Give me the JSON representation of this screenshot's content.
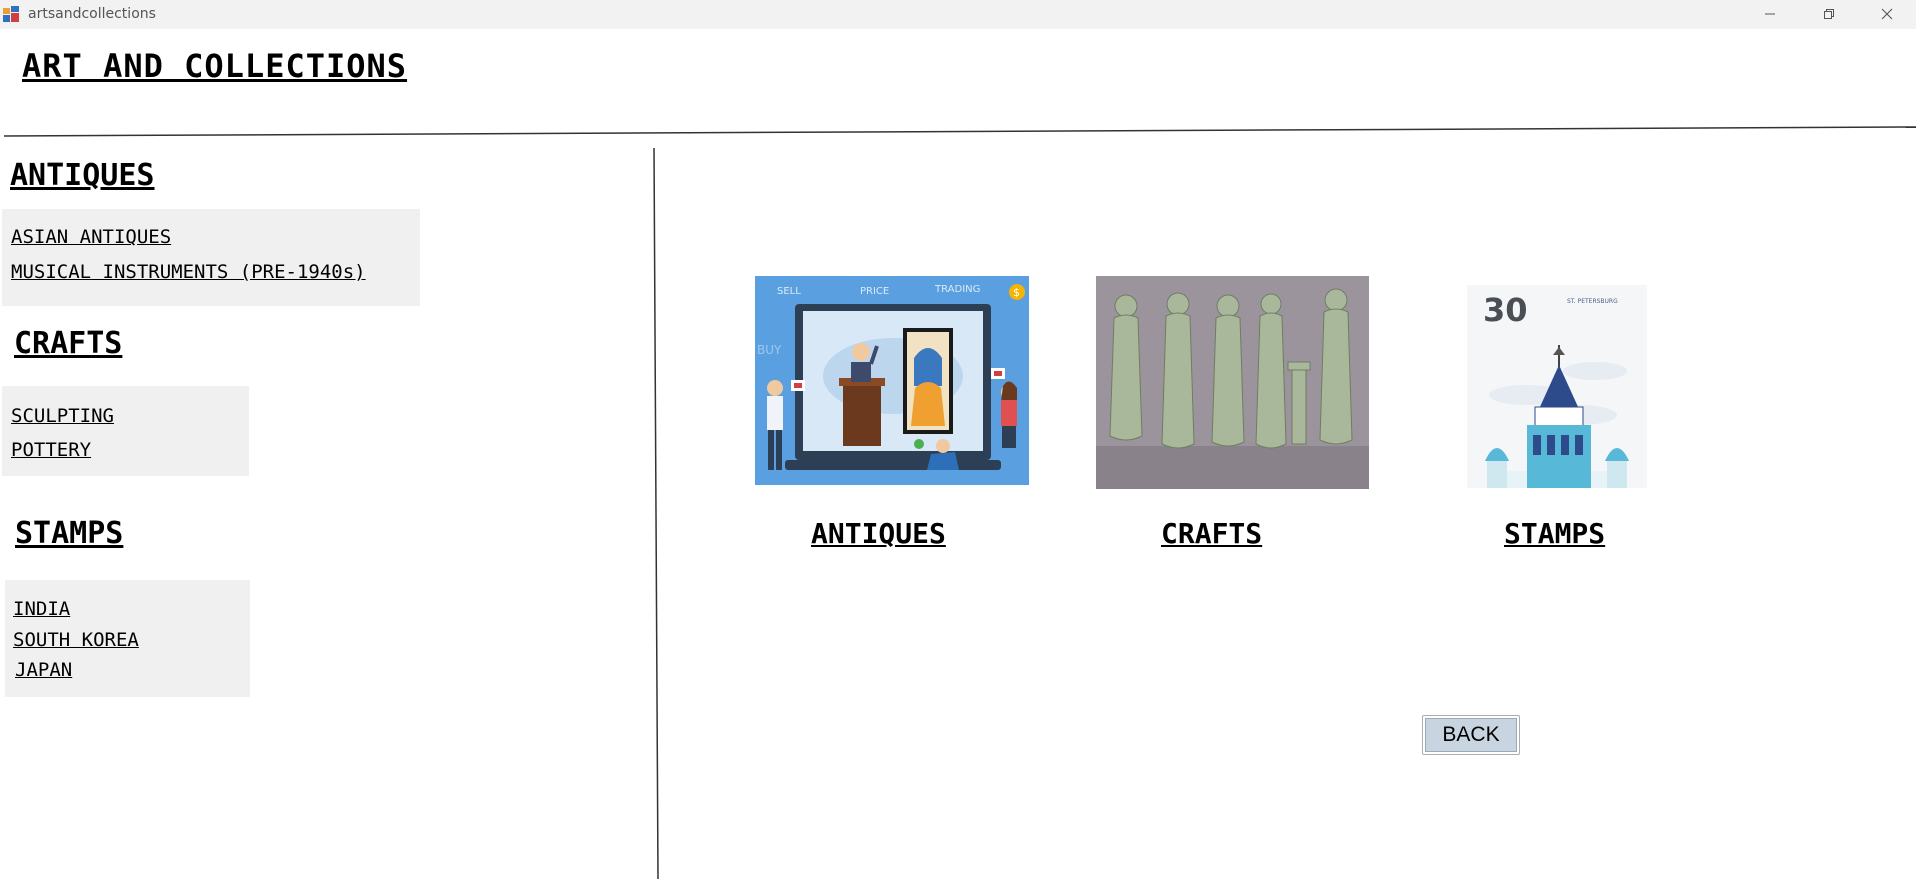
{
  "window": {
    "title": "artsandcollections"
  },
  "header": {
    "title": "ART AND COLLECTIONS"
  },
  "sidebar": {
    "sections": [
      {
        "heading": "ANTIQUES",
        "items": [
          "ASIAN ANTIQUES",
          "MUSICAL INSTRUMENTS (PRE-1940s)"
        ]
      },
      {
        "heading": "CRAFTS",
        "items": [
          "SCULPTING",
          "POTTERY"
        ]
      },
      {
        "heading": "STAMPS",
        "items": [
          "INDIA",
          "SOUTH KOREA",
          "JAPAN"
        ]
      }
    ]
  },
  "main": {
    "categories": [
      {
        "label": "ANTIQUES",
        "image_texts": [
          "SELL",
          "PRICE",
          "TRADING",
          "$",
          "BUY"
        ]
      },
      {
        "label": "CRAFTS"
      },
      {
        "label": "STAMPS",
        "stamp_value": "30",
        "stamp_caption": "ST. PETERSBURG"
      }
    ],
    "back_label": "BACK"
  },
  "colors": {
    "titlebar": "#f2f2f2",
    "panel": "#f0f0f0",
    "back_button": "#c8d4e0",
    "antiques_bg": "#5aa0e0",
    "crafts_bg": "#9c949c"
  },
  "icons": [
    "app-icon",
    "minimize-icon",
    "maximize-icon",
    "close-icon"
  ]
}
